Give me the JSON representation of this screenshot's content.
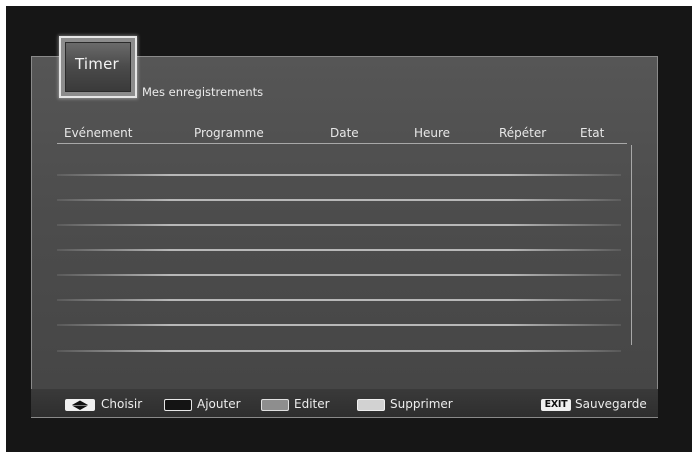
{
  "tab": {
    "title": "Timer"
  },
  "subtitle": "Mes enregistrements",
  "columns": [
    "Evénement",
    "Programme",
    "Date",
    "Heure",
    "Répéter",
    "Etat"
  ],
  "footer": {
    "choose": "Choisir",
    "add": "Ajouter",
    "edit": "Editer",
    "delete": "Supprimer",
    "exit_key": "EXIT",
    "save": "Sauvegarde"
  },
  "colors": {
    "screen_bg": "#161616",
    "panel_bg": "#4c4c4c",
    "text": "#e8e8e8"
  }
}
